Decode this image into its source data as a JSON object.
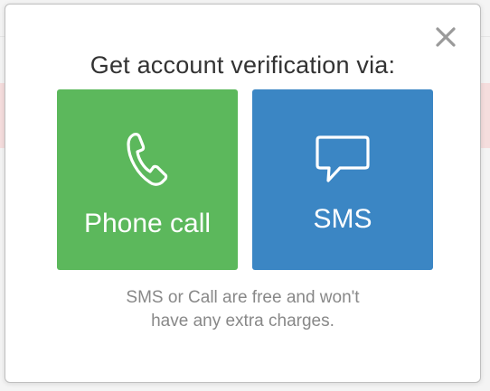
{
  "dialog": {
    "title": "Get account verification via:",
    "close_icon": "close-icon",
    "options": [
      {
        "label": "Phone call",
        "icon": "phone-icon",
        "color": "#5cb85c"
      },
      {
        "label": "SMS",
        "icon": "chat-bubble-icon",
        "color": "#3b86c4"
      }
    ],
    "note_lines": [
      "SMS or Call are free and won't",
      "have any extra charges."
    ]
  }
}
